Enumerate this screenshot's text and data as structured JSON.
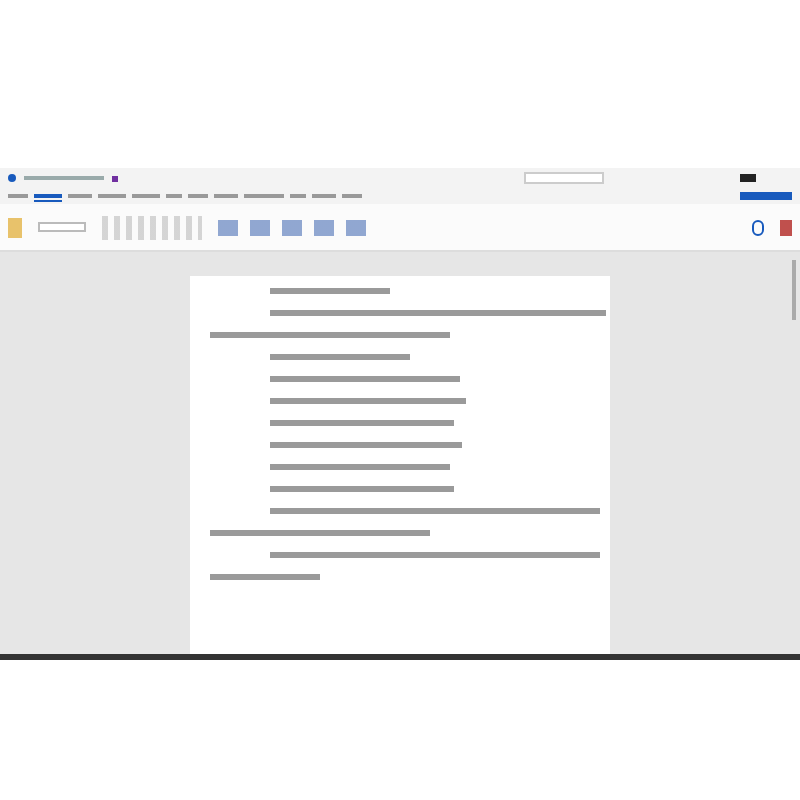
{
  "ribbon": {
    "tabs": [
      {
        "selected": false
      },
      {
        "selected": true
      },
      {
        "selected": false
      },
      {
        "selected": false
      },
      {
        "selected": false
      },
      {
        "selected": false
      },
      {
        "selected": false
      },
      {
        "selected": false
      },
      {
        "selected": false
      },
      {
        "selected": false
      },
      {
        "selected": false
      },
      {
        "selected": false
      }
    ]
  }
}
